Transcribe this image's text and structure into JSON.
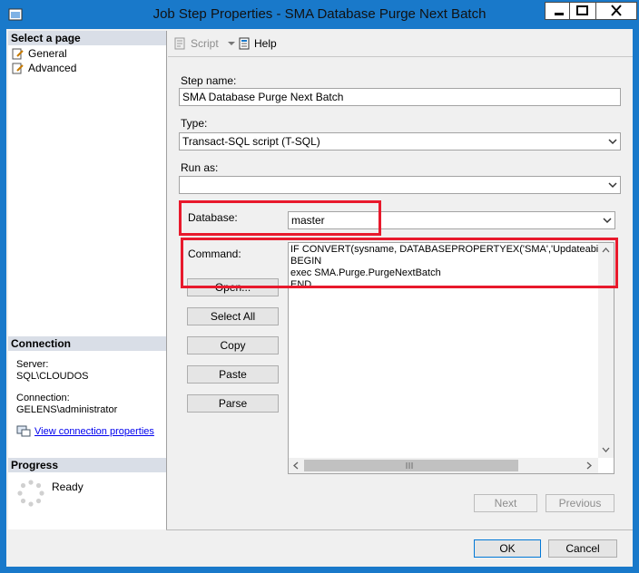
{
  "window": {
    "title": "Job Step Properties - SMA Database Purge Next Batch"
  },
  "left": {
    "select_page_header": "Select a page",
    "pages": [
      {
        "label": "General"
      },
      {
        "label": "Advanced"
      }
    ],
    "connection_header": "Connection",
    "server_label": "Server:",
    "server_value": "SQL\\CLOUDOS",
    "connection_label": "Connection:",
    "connection_value": "GELENS\\administrator",
    "view_connection_link": "View connection properties",
    "progress_header": "Progress",
    "progress_status": "Ready"
  },
  "toolbar": {
    "script_label": "Script",
    "help_label": "Help"
  },
  "form": {
    "step_name_label": "Step name:",
    "step_name_value": "SMA Database Purge Next Batch",
    "type_label": "Type:",
    "type_value": "Transact-SQL script (T-SQL)",
    "run_as_label": "Run as:",
    "run_as_value": "",
    "database_label": "Database:",
    "database_value": "master",
    "command_label": "Command:",
    "command_lines": [
      "IF CONVERT(sysname, DATABASEPROPERTYEX('SMA','Updateability",
      "BEGIN",
      "exec SMA.Purge.PurgeNextBatch",
      "END"
    ]
  },
  "buttons": {
    "open": "Open...",
    "select_all": "Select All",
    "copy": "Copy",
    "paste": "Paste",
    "parse": "Parse",
    "next": "Next",
    "previous": "Previous",
    "ok": "OK",
    "cancel": "Cancel"
  },
  "colors": {
    "title_bar": "#1979ca",
    "highlight": "#e8192c"
  }
}
